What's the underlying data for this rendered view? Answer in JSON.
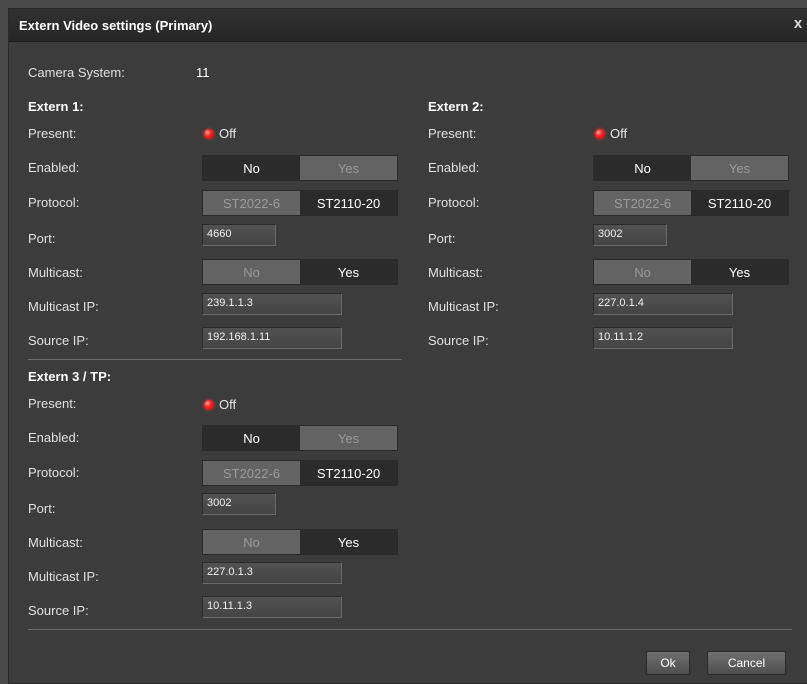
{
  "dialog": {
    "title": "Extern Video settings (Primary)",
    "close_glyph": "x"
  },
  "camera_system": {
    "label": "Camera System:",
    "value": "11"
  },
  "labels": {
    "present": "Present:",
    "enabled": "Enabled:",
    "protocol": "Protocol:",
    "port": "Port:",
    "multicast": "Multicast:",
    "multicast_ip": "Multicast IP:",
    "source_ip": "Source IP:"
  },
  "externs": [
    {
      "title": "Extern 1:",
      "present": "Off",
      "enabled": {
        "no": "No",
        "yes": "Yes",
        "selected": "No"
      },
      "protocol": {
        "a": "ST2022-6",
        "b": "ST2110-20",
        "selected": "ST2110-20"
      },
      "port": "4660",
      "multicast": {
        "no": "No",
        "yes": "Yes",
        "selected": "Yes"
      },
      "multicast_ip": "239.1.1.3",
      "source_ip": "192.168.1.11"
    },
    {
      "title": "Extern 2:",
      "present": "Off",
      "enabled": {
        "no": "No",
        "yes": "Yes",
        "selected": "No"
      },
      "protocol": {
        "a": "ST2022-6",
        "b": "ST2110-20",
        "selected": "ST2110-20"
      },
      "port": "3002",
      "multicast": {
        "no": "No",
        "yes": "Yes",
        "selected": "Yes"
      },
      "multicast_ip": "227.0.1.4",
      "source_ip": "10.11.1.2"
    },
    {
      "title": "Extern 3 / TP:",
      "present": "Off",
      "enabled": {
        "no": "No",
        "yes": "Yes",
        "selected": "No"
      },
      "protocol": {
        "a": "ST2022-6",
        "b": "ST2110-20",
        "selected": "ST2110-20"
      },
      "port": "3002",
      "multicast": {
        "no": "No",
        "yes": "Yes",
        "selected": "Yes"
      },
      "multicast_ip": "227.0.1.3",
      "source_ip": "10.11.1.3"
    }
  ],
  "buttons": {
    "ok": "Ok",
    "cancel": "Cancel"
  },
  "colors": {
    "led_off": "#ff2a2a",
    "background": "#3c3c3c",
    "titlebar": "#262626"
  }
}
